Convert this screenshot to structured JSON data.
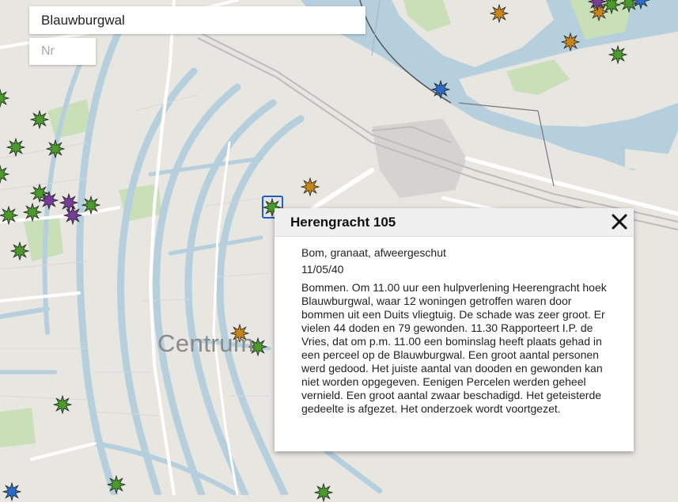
{
  "search": {
    "value": "Blauwburgwal",
    "nr_placeholder": "Nr"
  },
  "map": {
    "district_label": "Centrum",
    "colors": {
      "land": "#e7e6e1",
      "water": "#b6cfdd",
      "park": "#c8dfb8",
      "road_main": "#ffffff",
      "rail": "#bcbcbc"
    }
  },
  "markers": [
    {
      "type": "incident",
      "color": "#4a9a2c"
    },
    {
      "type": "incident",
      "color": "#c8861a"
    },
    {
      "type": "incident",
      "color": "#7a3c9a"
    },
    {
      "type": "incident",
      "color": "#2d6bc8"
    }
  ],
  "popup": {
    "title": "Herengracht 105",
    "type": "Bom, granaat, afweergeschut",
    "date": "11/05/40",
    "description": "Bommen. Om 11.00 uur een hulpverlening Heerengracht hoek Blauwburgwal, waar 12 woningen getroffen waren door bommen uit een Duits vliegtuig. De schade was zeer groot. Er vielen 44 doden en 79 gewonden. 11.30 Rapporteert I.P. de Vries, dat om p.m. 11.00 een bominslag heeft plaats gehad in een perceel op de Blauwburgwal. Een groot aantal personen werd gedood. Het juiste aantal van dooden en gewonden kan niet worden opgegeven. Eenigen Percelen werden geheel vernield. Een groot aantal zwaar beschadigd. Het geteisterde gedeelte is afgezet. Het onderzoek wordt voortgezet.",
    "close_icon": "close-icon"
  }
}
